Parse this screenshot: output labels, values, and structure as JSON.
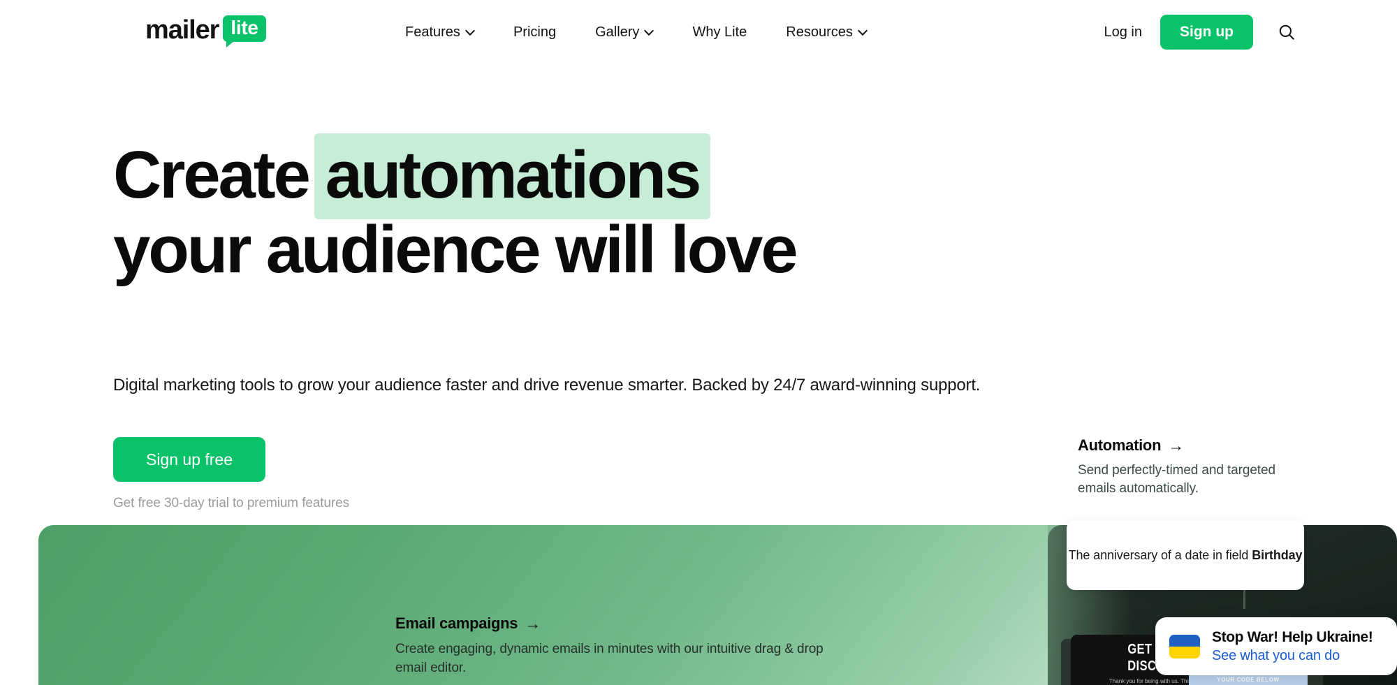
{
  "header": {
    "logo": {
      "word": "mailer",
      "badge": "lite"
    },
    "nav": [
      {
        "label": "Features",
        "has_chevron": true,
        "icon": "chevron-down-icon"
      },
      {
        "label": "Pricing",
        "has_chevron": false,
        "icon": ""
      },
      {
        "label": "Gallery",
        "has_chevron": true,
        "icon": "chevron-down-icon"
      },
      {
        "label": "Why Lite",
        "has_chevron": false,
        "icon": ""
      },
      {
        "label": "Resources",
        "has_chevron": true,
        "icon": "chevron-down-icon"
      }
    ],
    "login_label": "Log in",
    "signup_label": "Sign up",
    "search_icon": "search-icon"
  },
  "hero": {
    "headline_line1_plain": "Create",
    "headline_line1_highlight": "automations",
    "headline_line2": "your audience will love",
    "highlight_color": "#c6eed6",
    "subheading": "Digital marketing tools to grow your audience faster and drive revenue smarter. Backed by 24/7 award-winning support.",
    "cta_label": "Sign up free",
    "cta_note": "Get free 30-day trial to premium features",
    "accent_color": "#09c269"
  },
  "feature_cards": {
    "automation": {
      "title": "Automation",
      "arrow": "→",
      "description": "Send perfectly-timed and targeted emails automatically."
    },
    "email_campaigns": {
      "title": "Email campaigns",
      "arrow": "→",
      "description": "Create engaging, dynamic emails in minutes with our intuitive drag & drop email editor."
    }
  },
  "tooltip": {
    "text_prefix": "The anniversary of a date in field ",
    "text_bold": "Birthday"
  },
  "email_mockup": {
    "line1": "GET YOUR",
    "line2": "DISCOUNT",
    "subtext": "Thank you for being with us. This is how",
    "code_band_label": "YOUR CODE BELOW"
  },
  "ukraine_banner": {
    "flag_icon": "ukraine-flag-icon",
    "title": "Stop War! Help Ukraine!",
    "link_label": "See what you can do",
    "link_color": "#1a5bd6",
    "flag_blue": "#1f62c4",
    "flag_yellow": "#fed500"
  }
}
